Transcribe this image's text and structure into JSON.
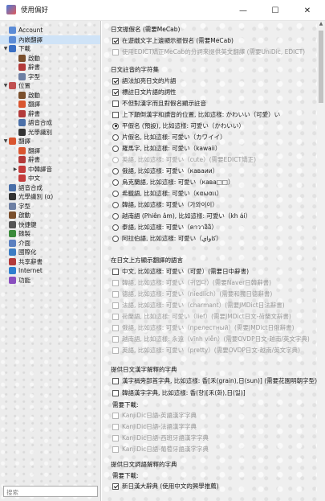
{
  "window": {
    "title": "使用偏好",
    "minimize": "—",
    "maximize": "☐",
    "close": "✕"
  },
  "sidebar": {
    "items": [
      {
        "label": "Account",
        "level": 0,
        "expander": "",
        "icon": "account-icon",
        "color": "#5b8bd6",
        "selected": false
      },
      {
        "label": "內嵌翻譯",
        "level": 0,
        "expander": "",
        "icon": "embedded-translation-icon",
        "color": "#5b8bd6",
        "selected": true
      },
      {
        "label": "下載",
        "level": 0,
        "expander": "▼",
        "icon": "download-icon",
        "color": "#3a6fc4",
        "selected": false
      },
      {
        "label": "啟動",
        "level": 1,
        "expander": "",
        "icon": "launch-icon",
        "color": "#7a4f2c",
        "selected": false
      },
      {
        "label": "辭書",
        "level": 1,
        "expander": "",
        "icon": "dictionary-icon",
        "color": "#b33a3a",
        "selected": false
      },
      {
        "label": "字型",
        "level": 1,
        "expander": "",
        "icon": "font-icon",
        "color": "#6d7fa3",
        "selected": false
      },
      {
        "label": "位置",
        "level": 0,
        "expander": "▼",
        "icon": "location-icon",
        "color": "#c05050",
        "selected": false
      },
      {
        "label": "啟動",
        "level": 1,
        "expander": "",
        "icon": "launch-icon",
        "color": "#7a4f2c",
        "selected": false
      },
      {
        "label": "翻譯",
        "level": 1,
        "expander": "",
        "icon": "translation-icon",
        "color": "#d9552f",
        "selected": false
      },
      {
        "label": "辭書",
        "level": 1,
        "expander": "",
        "icon": "dictionary-icon",
        "color": "#b33a3a",
        "selected": false
      },
      {
        "label": "語音合成",
        "level": 1,
        "expander": "",
        "icon": "speech-icon",
        "color": "#4a6fa8",
        "selected": false
      },
      {
        "label": "光學識別",
        "level": 1,
        "expander": "",
        "icon": "ocr-icon",
        "color": "#333333",
        "selected": false
      },
      {
        "label": "翻譯",
        "level": 0,
        "expander": "▼",
        "icon": "translation-icon",
        "color": "#d9552f",
        "selected": false
      },
      {
        "label": "翻譯",
        "level": 1,
        "expander": "",
        "icon": "translation-icon",
        "color": "#d9552f",
        "selected": false
      },
      {
        "label": "辭書",
        "level": 1,
        "expander": "",
        "icon": "dictionary-icon",
        "color": "#b33a3a",
        "selected": false
      },
      {
        "label": "中韓譯音",
        "level": 1,
        "expander": "▶",
        "icon": "chinese-korean-icon",
        "color": "#c43c3c",
        "selected": false
      },
      {
        "label": "中文",
        "level": 1,
        "expander": "",
        "icon": "chinese-icon",
        "color": "#c43c3c",
        "selected": false
      },
      {
        "label": "語音合成",
        "level": 0,
        "expander": "",
        "icon": "speech-icon",
        "color": "#4a6fa8",
        "selected": false
      },
      {
        "label": "光學識別 (α)",
        "level": 0,
        "expander": "",
        "icon": "ocr-icon",
        "color": "#333333",
        "selected": false
      },
      {
        "label": "字型",
        "level": 0,
        "expander": "",
        "icon": "font-icon",
        "color": "#6d7fa3",
        "selected": false
      },
      {
        "label": "啟動",
        "level": 0,
        "expander": "",
        "icon": "launch-icon",
        "color": "#7a4f2c",
        "selected": false
      },
      {
        "label": "快捷鍵",
        "level": 0,
        "expander": "",
        "icon": "shortcut-icon",
        "color": "#555555",
        "selected": false
      },
      {
        "label": "錄製",
        "level": 0,
        "expander": "",
        "icon": "record-icon",
        "color": "#3b8a3b",
        "selected": false
      },
      {
        "label": "介面",
        "level": 0,
        "expander": "",
        "icon": "interface-icon",
        "color": "#5a7fbf",
        "selected": false
      },
      {
        "label": "國際化",
        "level": 0,
        "expander": "",
        "icon": "i18n-icon",
        "color": "#3c7dc4",
        "selected": false
      },
      {
        "label": "共享辭書",
        "level": 0,
        "expander": "",
        "icon": "shared-dictionary-icon",
        "color": "#b33a3a",
        "selected": false
      },
      {
        "label": "Internet",
        "level": 0,
        "expander": "",
        "icon": "internet-icon",
        "color": "#2f7fcf",
        "selected": false
      },
      {
        "label": "功能",
        "level": 0,
        "expander": "",
        "icon": "feature-icon",
        "color": "#8a4fbf",
        "selected": false
      }
    ],
    "search_placeholder": "搜索"
  },
  "content": {
    "section_japanese_kana": {
      "title": "日文振假名 (需要MeCab)",
      "items": [
        {
          "label": "在遊戲文字上邊顯示振假名 (需要MeCab)",
          "checked": true,
          "disabled": false
        },
        {
          "label": "使用EDICT矯正MeCab的分詞來提供英文翻譯 (需要UniDic, EDICT)",
          "checked": false,
          "disabled": true
        }
      ]
    },
    "section_japanese_phonetic": {
      "title": "日文註音的字符集",
      "checks": [
        {
          "label": "語法加亮日文的片語",
          "checked": true
        },
        {
          "label": "標註日文片語的詞性",
          "checked": true
        },
        {
          "label": "不但對漢字而且對假名顯示註音",
          "checked": false
        },
        {
          "label": "上下顛倒漢字和讀音的位置, 比如這樣: かわいい（可愛）い",
          "checked": false
        }
      ],
      "radios": [
        {
          "label": "平假名 (預設), 比如這樣: 可愛い（かわいい）",
          "selected": true,
          "disabled": false
        },
        {
          "label": "片假名, 比如這樣: 可愛い（カワイイ）",
          "selected": false,
          "disabled": false
        },
        {
          "label": "羅馬字, 比如這樣: 可愛い（kawaii）",
          "selected": false,
          "disabled": false
        },
        {
          "label": "英語, 比如這樣: 可愛い（cute）(需要EDICT矯正)",
          "selected": false,
          "disabled": true
        },
        {
          "label": "俄語, 比如這樣: 可愛い（каваии）",
          "selected": false,
          "disabled": false
        },
        {
          "label": "烏克蘭語, 比如這樣: 可愛い（кава□□）",
          "selected": false,
          "disabled": false
        },
        {
          "label": "希臘語, 比如這樣: 可愛い（καωαιι）",
          "selected": false,
          "disabled": false
        },
        {
          "label": "韓語, 比如這樣: 可愛い（가와이이）",
          "selected": false,
          "disabled": false
        },
        {
          "label": "越南語 (Phiên âm), 比如這樣: 可愛い（kh ái）",
          "selected": false,
          "disabled": false
        },
        {
          "label": "泰語, 比如這樣: 可愛い（คาวาอิอิ）",
          "selected": false,
          "disabled": false
        },
        {
          "label": "阿拉伯語, 比如這樣: 可愛い（كاواي）",
          "selected": false,
          "disabled": false
        }
      ]
    },
    "section_above_japanese": {
      "title": "在日文上方顯示翻譯的語言",
      "items": [
        {
          "label": "中文, 比如這樣: 可愛い（可愛）(需要日中辭書)",
          "checked": false,
          "disabled": false
        },
        {
          "label": "韓語, 比如這樣: 可愛い（귀엽다）(需要Naver日韓辭書)",
          "checked": false,
          "disabled": true
        },
        {
          "label": "德語, 比如這樣: 可愛い（niedlich）(需要和獨日德辭書)",
          "checked": false,
          "disabled": true
        },
        {
          "label": "法語, 比如這樣: 可愛い（charmant）(需要JMDict日法辭書)",
          "checked": false,
          "disabled": true
        },
        {
          "label": "荷蘭語, 比如這樣: 可愛い（lief）(需要JMDict日文-荷蘭文辭書)",
          "checked": false,
          "disabled": true
        },
        {
          "label": "俄語, 比如這樣: 可愛い（прелестный）(需要JMDict日俄辭書)",
          "checked": false,
          "disabled": true
        },
        {
          "label": "越南語, 比如這樣: 永遠（vĩnh viễn）(需要OVDP日文-越南/英文字典)",
          "checked": false,
          "disabled": true
        },
        {
          "label": "英語, 比如這樣: 可愛い（pretty）(需要OVDP日文-越南/英文字典)",
          "checked": false,
          "disabled": true
        }
      ]
    },
    "section_kanji_dict": {
      "title": "提供日文漢字解釋的字典",
      "items": [
        {
          "label": "漢字稱旁部首字典, 比如這樣: 香[禾(grain),日(sun)] (需要花園明朝字型)",
          "checked": false,
          "disabled": false
        },
        {
          "label": "韓語漢字字典, 比如這樣: 香(향)[禾(화),日(일)]",
          "checked": false,
          "disabled": false
        }
      ],
      "download_label": "需要下載:",
      "downloads": [
        {
          "label": "KanjiDic日語-英語漢字字典",
          "checked": false
        },
        {
          "label": "KanjiDic日語-法語漢字字典",
          "checked": false
        },
        {
          "label": "KanjiDic日語-西班牙語漢字字典",
          "checked": false
        },
        {
          "label": "KanjiDic日語-葡萄牙語漢字字典",
          "checked": false
        }
      ]
    },
    "section_word_dict": {
      "title": "提供日文詞語解釋的字典",
      "download_label": "需要下載:",
      "items": [
        {
          "label": "新日漢大辭典 (使用中文的興學推薦)",
          "checked": true,
          "disabled": false
        }
      ]
    }
  }
}
